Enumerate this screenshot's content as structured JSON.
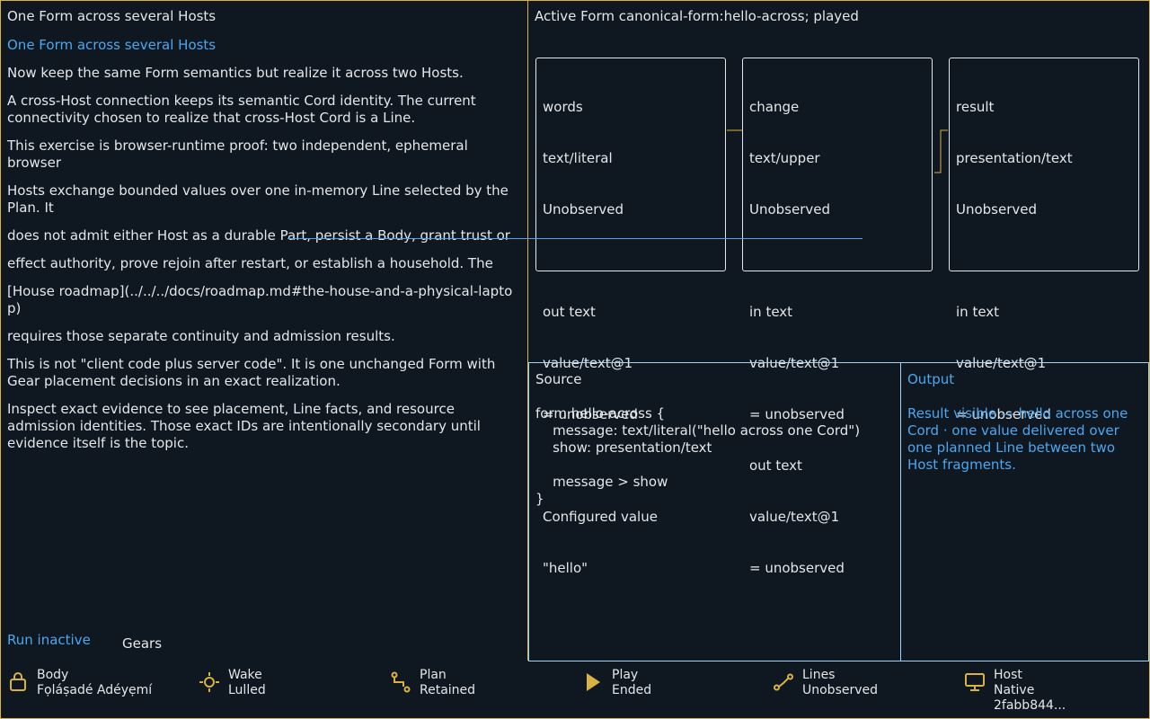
{
  "left": {
    "title": "One Form across several Hosts",
    "heading": "One Form across several Hosts",
    "paragraphs": [
      "Now keep the same Form semantics but realize it across two Hosts.",
      "A cross-Host connection keeps its semantic Cord identity. The current connectivity chosen to realize that cross-Host Cord is a Line.",
      "This exercise is browser-runtime proof: two independent, ephemeral browser",
      "Hosts exchange bounded values over one in-memory Line selected by the Plan. It",
      "does not admit either Host as a durable Part, persist a Body, grant trust or",
      "effect authority, prove rejoin after restart, or establish a household. The",
      "[House roadmap](../../../docs/roadmap.md#the-house-and-a-physical-laptop)",
      "requires those separate continuity and admission results.",
      "This is not \"client code plus server code\". It is one unchanged Form with Gear placement decisions in an exact realization.",
      "Inspect exact evidence to see placement, Line facts, and resource admission identities. Those exact IDs are intentionally secondary until evidence itself is the topic."
    ],
    "run_label": "Run inactive",
    "gears_label": "Gears"
  },
  "graph": {
    "title": "Active Form canonical-form:hello-across; played",
    "nodes": [
      {
        "lines": [
          "words",
          "text/literal",
          "Unobserved",
          "",
          "out text",
          "value/text@1",
          "= unobserved",
          "",
          "Configured value",
          "\"hello\""
        ]
      },
      {
        "lines": [
          "change",
          "text/upper",
          "Unobserved",
          "",
          "in text",
          "value/text@1",
          "= unobserved",
          "out text",
          "value/text@1",
          "= unobserved"
        ]
      },
      {
        "lines": [
          "result",
          "presentation/text",
          "Unobserved",
          "",
          "in text",
          "value/text@1",
          "= unobserved"
        ]
      }
    ],
    "wire_color": "#d8b243",
    "line_color": "#4aa8f0"
  },
  "source": {
    "label": "Source",
    "code": "form hello-across {\n    message: text/literal(\"hello across one Cord\")\n    show: presentation/text\n\n    message > show\n}"
  },
  "output": {
    "label": "Output",
    "text": "Result visible — hello across one Cord · one value delivered over one planned Line between two Host fragments."
  },
  "status": [
    {
      "icon": "body-icon",
      "name": "Body",
      "value": "Fọláṣadé Adéyẹmí"
    },
    {
      "icon": "wake-icon",
      "name": "Wake",
      "value": "Lulled"
    },
    {
      "icon": "plan-icon",
      "name": "Plan",
      "value": "Retained"
    },
    {
      "icon": "play-icon",
      "name": "Play",
      "value": "Ended"
    },
    {
      "icon": "lines-icon",
      "name": "Lines",
      "value": "Unobserved"
    },
    {
      "icon": "host-icon",
      "name": "Host",
      "value": "Native",
      "extra": "2fabb844..."
    }
  ],
  "colors": {
    "accent": "#d8b243",
    "link": "#4aa8f0",
    "background": "#0f1720",
    "text": "#e4e7ea"
  }
}
